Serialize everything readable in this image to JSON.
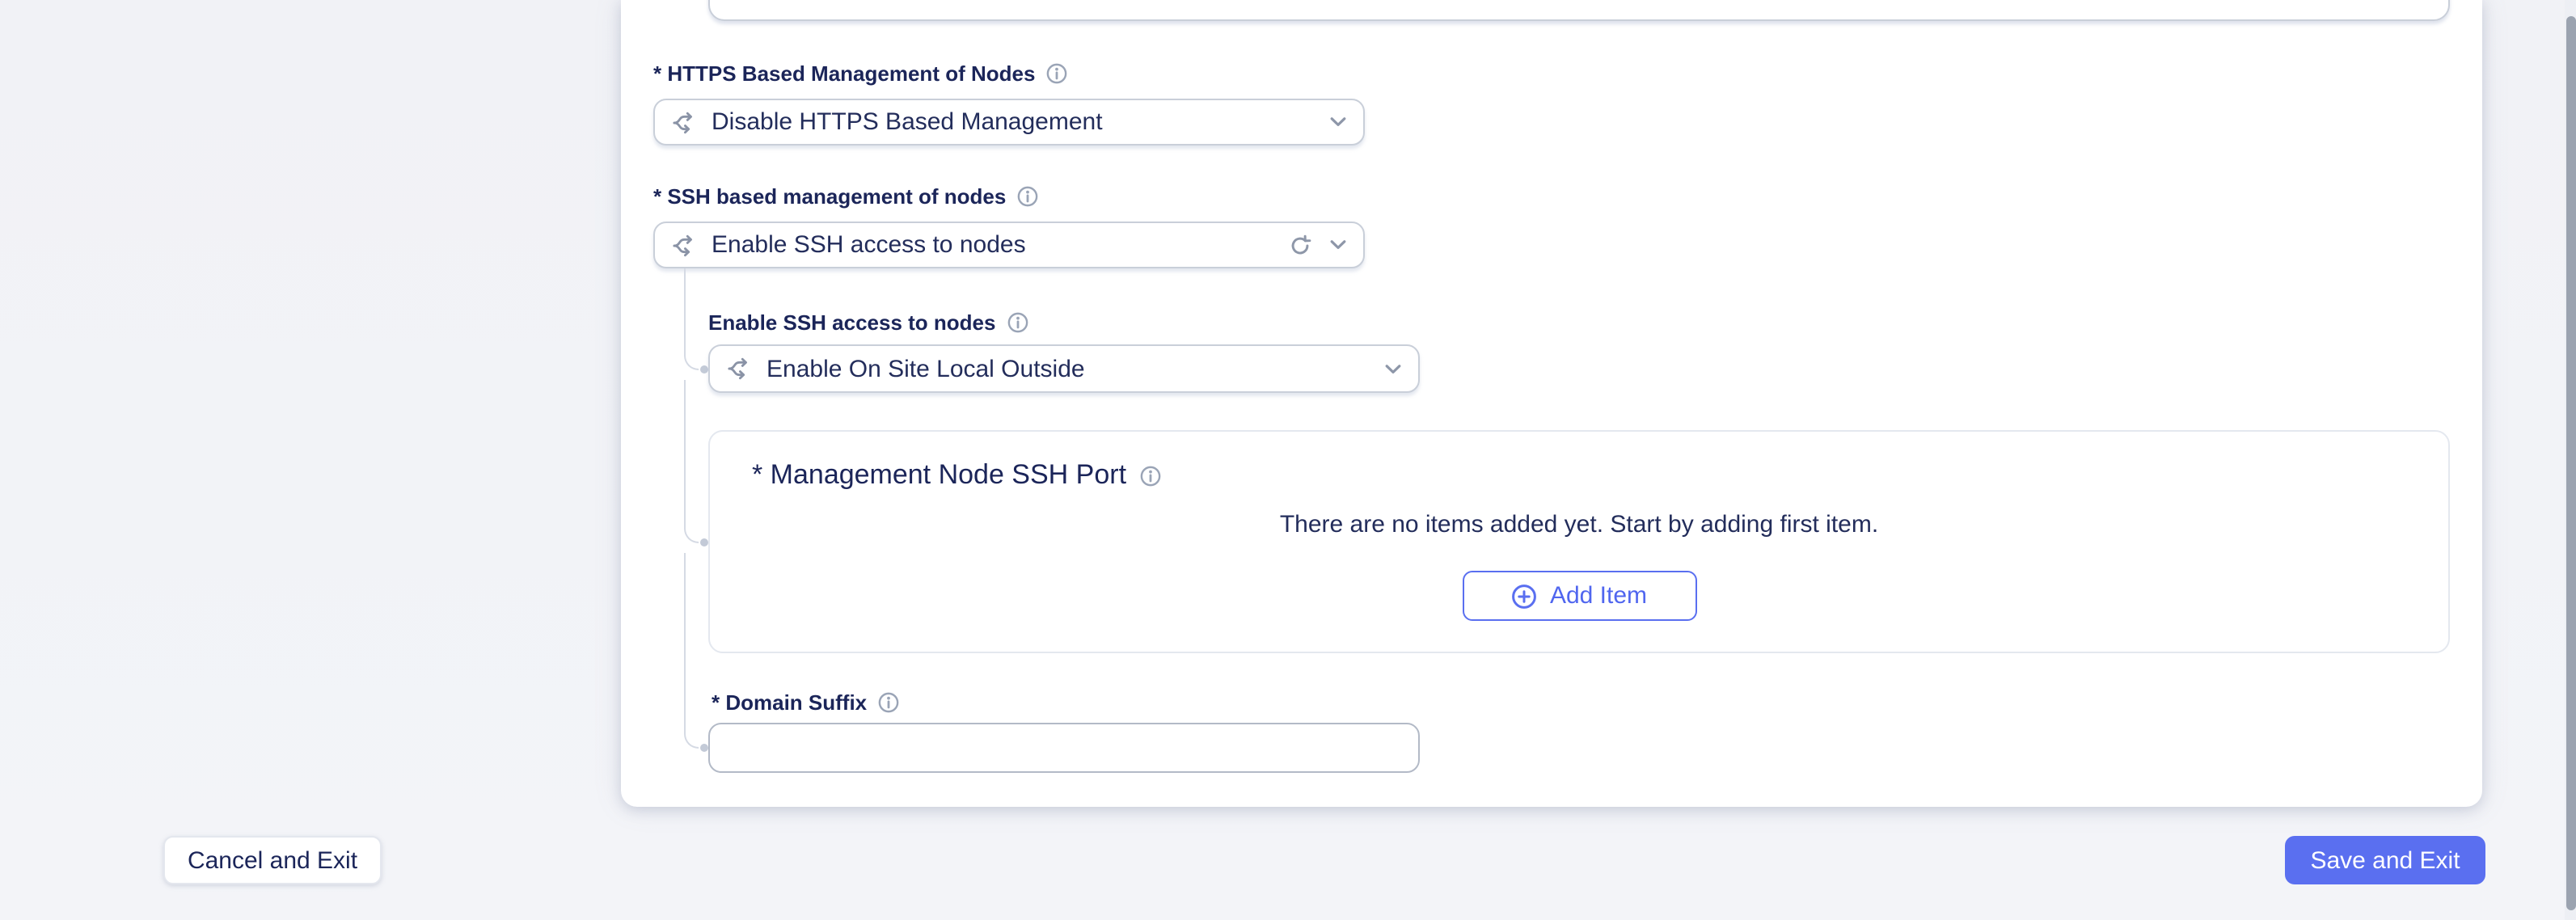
{
  "colors": {
    "accent_blue": "#5a6ff0",
    "label_navy": "#1b2559",
    "value_navy": "#232d5b",
    "icon_gray": "#8e97a9",
    "border_gray": "#c9cfd9",
    "connector_gray": "#d5dae4",
    "card_bg": "#ffffff",
    "page_bg": "#f2f3f7"
  },
  "icons": {
    "field_type": "branch-split-arrows-icon",
    "info": "circled-i-icon",
    "expand": "chevron-down-icon",
    "reset": "reload-arrow-icon",
    "add": "plus-in-circle-icon"
  },
  "form": {
    "top_partial_input": {
      "value": ""
    },
    "https_management": {
      "label": "* HTTPS Based Management of Nodes",
      "value": "Disable HTTPS Based Management"
    },
    "ssh_management": {
      "label": "* SSH based management of nodes",
      "value": "Enable SSH access to nodes"
    },
    "ssh_access": {
      "label": "Enable SSH access to nodes",
      "value": "Enable On Site Local Outside"
    },
    "ssh_port_list": {
      "title": "* Management Node SSH Port",
      "empty_message": "There are no items added yet. Start by adding first item.",
      "add_button_label": "Add Item"
    },
    "domain_suffix": {
      "label": "* Domain Suffix",
      "value": ""
    }
  },
  "footer": {
    "cancel_label": "Cancel and Exit",
    "save_label": "Save and Exit"
  }
}
